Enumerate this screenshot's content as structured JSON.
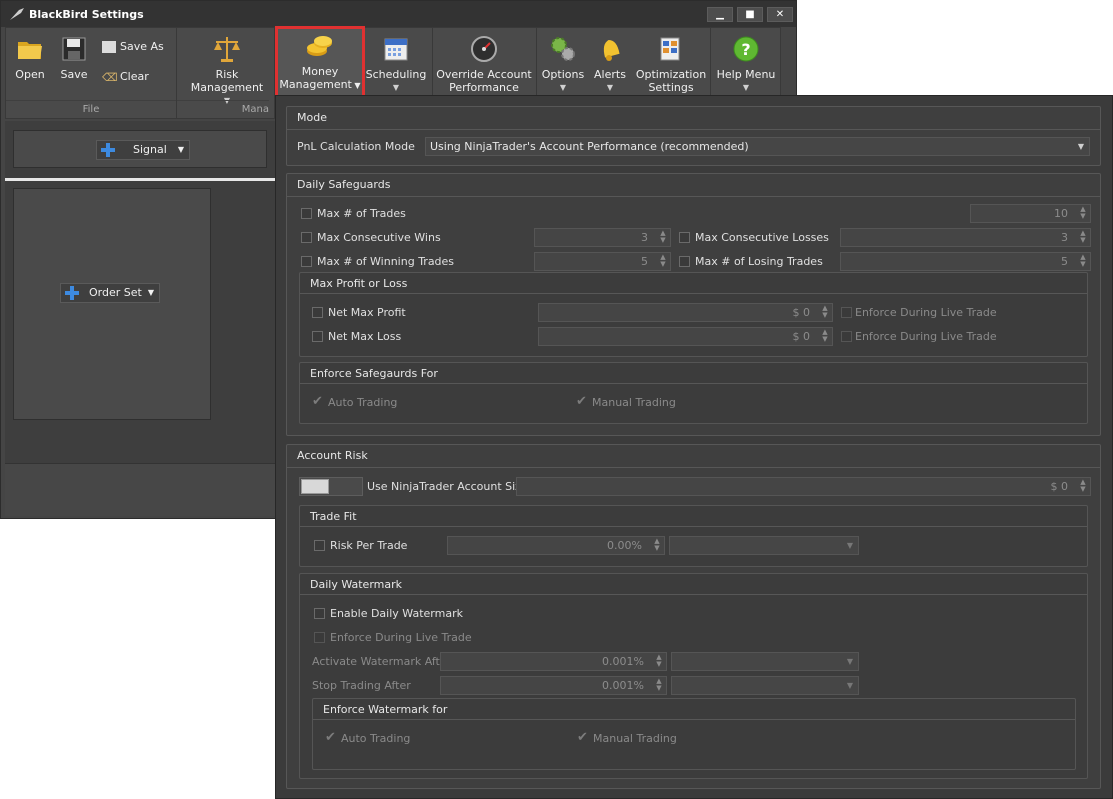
{
  "window": {
    "title": "BlackBird Settings",
    "minimize": "▁",
    "maximize": "■",
    "close": "✕"
  },
  "ribbon": {
    "file_group_label": "File",
    "management_group_label": "Mana",
    "open": "Open",
    "save": "Save",
    "save_as": "Save  As",
    "clear": "Clear",
    "risk_management": "Risk Management",
    "money_management_line1": "Money",
    "money_management_line2": "Management",
    "scheduling": "Scheduling",
    "override_line1": "Override Account",
    "override_line2": "Performance",
    "options": "Options",
    "alerts": "Alerts",
    "optimization_line1": "Optimization",
    "optimization_line2": "Settings",
    "help_menu": "Help Menu"
  },
  "left": {
    "signal": "Signal",
    "order_set": "Order Set"
  },
  "mode": {
    "title": "Mode",
    "pnl_label": "PnL Calculation Mode",
    "pnl_value": "Using NinjaTrader's Account Performance (recommended)"
  },
  "daily": {
    "title": "Daily Safeguards",
    "max_trades": "Max # of Trades",
    "max_trades_val": "10",
    "max_cons_wins": "Max Consecutive Wins",
    "max_cons_wins_val": "3",
    "max_cons_losses": "Max Consecutive Losses",
    "max_cons_losses_val": "3",
    "max_winning": "Max # of Winning Trades",
    "max_winning_val": "5",
    "max_losing": "Max # of Losing Trades",
    "max_losing_val": "5",
    "pl_title": "Max Profit or Loss",
    "net_profit": "Net Max Profit",
    "net_profit_val": "$ 0",
    "net_loss": "Net Max Loss",
    "net_loss_val": "$ 0",
    "enforce_live": "Enforce During Live Trade",
    "enforce_title": "Enforce Safegaurds For",
    "auto": "Auto Trading",
    "manual": "Manual Trading"
  },
  "account": {
    "title": "Account Risk",
    "use_size": "Use NinjaTrader Account Size",
    "size_val": "$ 0",
    "trade_fit_title": "Trade Fit",
    "risk_per_trade": "Risk Per Trade",
    "risk_val": "0.00%",
    "watermark_title": "Daily Watermark",
    "enable_watermark": "Enable Daily Watermark",
    "enforce_live": "Enforce During Live Trade",
    "activate_after": "Activate Watermark After",
    "activate_val": "0.001%",
    "stop_after": "Stop Trading After",
    "stop_val": "0.001%",
    "enforce_for_title": "Enforce Watermark for",
    "auto": "Auto Trading",
    "manual": "Manual Trading"
  }
}
